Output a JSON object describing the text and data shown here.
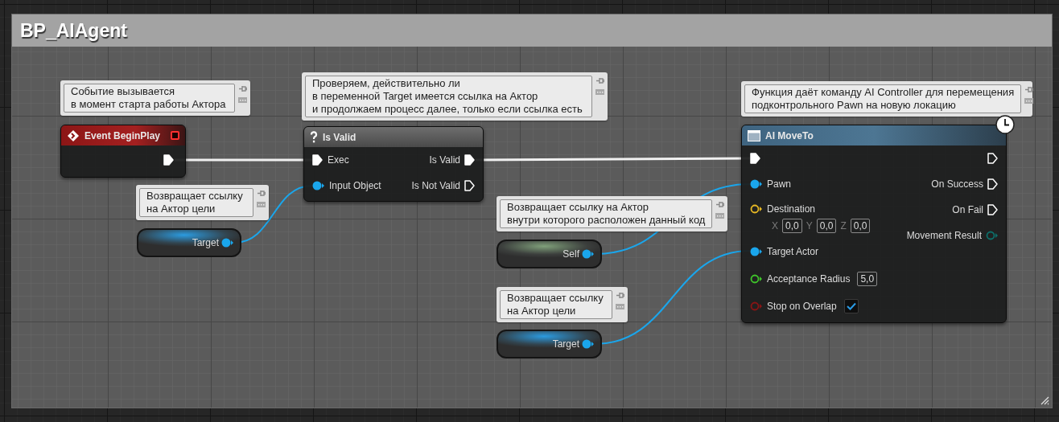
{
  "comment_box": {
    "title": "BP_AIAgent"
  },
  "nodes": [
    {
      "kind": "event",
      "title": "Event BeginPlay",
      "comment": "Событие вызывается\nв момент старта работы Актора",
      "outputs": [
        {
          "kind": "exec",
          "connected": true
        }
      ]
    },
    {
      "kind": "macro",
      "title": "Is Valid",
      "comment": "Проверяем, действительно ли\nв переменной Target имеется ссылка на Актор\nи продолжаем процесс далее, только если ссылка есть",
      "inputs": [
        {
          "kind": "exec",
          "label": "Exec",
          "connected": true
        },
        {
          "kind": "object",
          "label": "Input Object",
          "connected": true
        }
      ],
      "outputs": [
        {
          "kind": "exec",
          "label": "Is Valid",
          "connected": true
        },
        {
          "kind": "exec",
          "label": "Is Not Valid",
          "connected": false
        }
      ]
    },
    {
      "kind": "variable",
      "title": "Target",
      "comment": "Возвращает ссылку\nна Актор цели",
      "outputs": [
        {
          "kind": "object",
          "connected": true
        }
      ]
    },
    {
      "kind": "function",
      "title": "AI MoveTo",
      "latent": true,
      "comment": "Функция даёт команду AI Controller для перемещения\nподконтрольного Pawn на новую локацию",
      "inputs": [
        {
          "kind": "exec",
          "connected": true
        },
        {
          "kind": "object",
          "label": "Pawn",
          "connected": true
        },
        {
          "kind": "vector",
          "label": "Destination",
          "connected": false,
          "values": [
            {
              "axis": "X",
              "value": "0,0"
            },
            {
              "axis": "Y",
              "value": "0,0"
            },
            {
              "axis": "Z",
              "value": "0,0"
            }
          ]
        },
        {
          "kind": "object",
          "label": "Target Actor",
          "connected": true
        },
        {
          "kind": "float",
          "label": "Acceptance Radius",
          "connected": false,
          "value": "5,0"
        },
        {
          "kind": "bool",
          "label": "Stop on Overlap",
          "connected": false,
          "checked": true
        }
      ],
      "outputs": [
        {
          "kind": "exec",
          "connected": false
        },
        {
          "kind": "exec",
          "label": "On Success",
          "connected": false
        },
        {
          "kind": "exec",
          "label": "On Fail",
          "connected": false
        },
        {
          "kind": "enum",
          "label": "Movement Result",
          "connected": false
        }
      ]
    },
    {
      "kind": "self",
      "title": "Self",
      "comment": "Возвращает ссылку на Актор\nвнутри которого расположен данный код",
      "outputs": [
        {
          "kind": "object",
          "connected": true
        }
      ]
    },
    {
      "kind": "variable",
      "title": "Target",
      "comment": "Возвращает ссылку\nна Актор цели",
      "outputs": [
        {
          "kind": "object",
          "connected": true
        }
      ]
    }
  ]
}
